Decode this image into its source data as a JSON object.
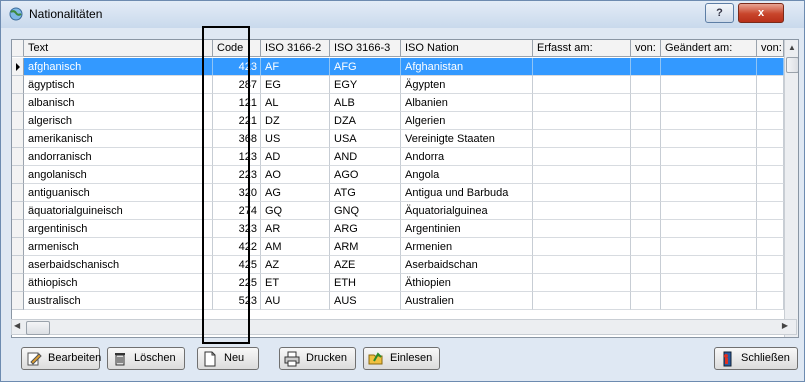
{
  "window": {
    "title": "Nationalitäten",
    "help_label": "?",
    "close_label": "x"
  },
  "columns": [
    "Text",
    "Code",
    "ISO 3166-2",
    "ISO 3166-3",
    "ISO Nation",
    "Erfasst am:",
    "von:",
    "Geändert am:",
    "von:"
  ],
  "rows": [
    {
      "text": "afghanisch",
      "code": "423",
      "iso2": "AF",
      "iso3": "AFG",
      "nation": "Afghanistan"
    },
    {
      "text": "ägyptisch",
      "code": "287",
      "iso2": "EG",
      "iso3": "EGY",
      "nation": "Ägypten"
    },
    {
      "text": "albanisch",
      "code": "121",
      "iso2": "AL",
      "iso3": "ALB",
      "nation": "Albanien"
    },
    {
      "text": "algerisch",
      "code": "221",
      "iso2": "DZ",
      "iso3": "DZA",
      "nation": "Algerien"
    },
    {
      "text": "amerikanisch",
      "code": "368",
      "iso2": "US",
      "iso3": "USA",
      "nation": "Vereinigte Staaten"
    },
    {
      "text": "andorranisch",
      "code": "123",
      "iso2": "AD",
      "iso3": "AND",
      "nation": "Andorra"
    },
    {
      "text": "angolanisch",
      "code": "223",
      "iso2": "AO",
      "iso3": "AGO",
      "nation": "Angola"
    },
    {
      "text": "antiguanisch",
      "code": "320",
      "iso2": "AG",
      "iso3": "ATG",
      "nation": "Antigua und Barbuda"
    },
    {
      "text": "äquatorialguineisch",
      "code": "274",
      "iso2": "GQ",
      "iso3": "GNQ",
      "nation": "Äquatorialguinea"
    },
    {
      "text": "argentinisch",
      "code": "323",
      "iso2": "AR",
      "iso3": "ARG",
      "nation": "Argentinien"
    },
    {
      "text": "armenisch",
      "code": "422",
      "iso2": "AM",
      "iso3": "ARM",
      "nation": "Armenien"
    },
    {
      "text": "aserbaidschanisch",
      "code": "425",
      "iso2": "AZ",
      "iso3": "AZE",
      "nation": "Aserbaidschan"
    },
    {
      "text": "äthiopisch",
      "code": "225",
      "iso2": "ET",
      "iso3": "ETH",
      "nation": "Äthiopien"
    },
    {
      "text": "australisch",
      "code": "523",
      "iso2": "AU",
      "iso3": "AUS",
      "nation": "Australien"
    }
  ],
  "selected_row_index": 0,
  "buttons": {
    "edit": "Bearbeiten",
    "delete": "Löschen",
    "new": "Neu",
    "print": "Drucken",
    "import": "Einlesen",
    "close": "Schließen"
  },
  "colors": {
    "selection": "#3399ff",
    "highlight_frame": "#000000"
  }
}
